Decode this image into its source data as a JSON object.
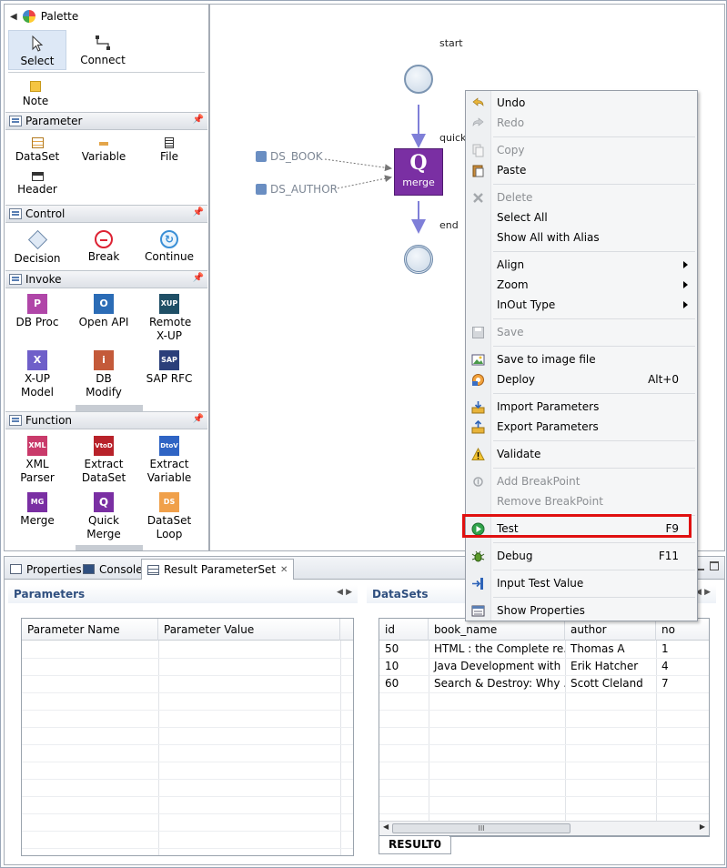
{
  "palette": {
    "title": "Palette",
    "tools": [
      {
        "label": "Select",
        "icon": "arrow-cursor-icon"
      },
      {
        "label": "Connect",
        "icon": "connect-icon"
      }
    ],
    "note_label": "Note",
    "sections": {
      "parameter": {
        "title": "Parameter",
        "items": [
          "DataSet",
          "Variable",
          "File",
          "Header"
        ]
      },
      "control": {
        "title": "Control",
        "items": [
          "Decision",
          "Break",
          "Continue"
        ]
      },
      "invoke": {
        "title": "Invoke",
        "items": [
          "DB Proc",
          "Open API",
          "Remote X-UP",
          "X-UP Model",
          "DB Modify",
          "SAP RFC"
        ]
      },
      "function": {
        "title": "Function",
        "items": [
          "XML Parser",
          "Extract DataSet",
          "Extract Variable",
          "Merge",
          "Quick Merge",
          "DataSet Loop"
        ]
      }
    },
    "icon_texts": {
      "dbproc": "P",
      "openapi": "O",
      "remotexup": "XUP",
      "xupmodel": "X",
      "dbmodify": "i",
      "saprfc": "SAP",
      "xmlparser": "XML",
      "extractds": "VtoD",
      "extractvar": "DtoV",
      "merge": "MG",
      "quickmerge": "Q",
      "dsloop": "DS"
    }
  },
  "canvas": {
    "start_label": "start",
    "end_label": "end",
    "quick_label": "quick",
    "ds_book": "DS_BOOK",
    "ds_author": "DS_AUTHOR",
    "node_letter": "Q",
    "node_sub": "merge"
  },
  "bottom": {
    "tabs": [
      "Properties",
      "Console",
      "Result ParameterSet"
    ],
    "parameters": {
      "title": "Parameters",
      "columns": [
        "Parameter Name",
        "Parameter Value"
      ]
    },
    "datasets": {
      "title": "DataSets",
      "columns": [
        "id",
        "book_name",
        "author",
        "no"
      ],
      "rows": [
        [
          "50",
          "HTML : the Complete re...",
          "Thomas A",
          "1"
        ],
        [
          "10",
          "Java Development with ...",
          "Erik Hatcher",
          "4"
        ],
        [
          "60",
          "Search & Destroy: Why ...",
          "Scott Cleland",
          "7"
        ]
      ],
      "sheet_tab": "RESULT0",
      "scroll_grip": "III"
    }
  },
  "context_menu": {
    "items": [
      {
        "label": "Undo",
        "icon": "undo-icon"
      },
      {
        "label": "Redo",
        "icon": "redo-icon",
        "disabled": true
      },
      {
        "label": "Copy",
        "icon": "copy-icon",
        "disabled": true
      },
      {
        "label": "Paste",
        "icon": "paste-icon"
      },
      {
        "label": "Delete",
        "icon": "delete-icon",
        "disabled": true
      },
      {
        "label": "Select All"
      },
      {
        "label": "Show All with Alias"
      },
      {
        "label": "Align",
        "submenu": true
      },
      {
        "label": "Zoom",
        "submenu": true
      },
      {
        "label": "InOut Type",
        "submenu": true
      },
      {
        "label": "Save",
        "icon": "save-icon",
        "disabled": true
      },
      {
        "label": "Save to image file",
        "icon": "image-icon"
      },
      {
        "label": "Deploy",
        "icon": "deploy-icon",
        "shortcut": "Alt+0"
      },
      {
        "label": "Import Parameters",
        "icon": "import-icon"
      },
      {
        "label": "Export Parameters",
        "icon": "export-icon"
      },
      {
        "label": "Validate",
        "icon": "warning-icon"
      },
      {
        "label": "Add BreakPoint",
        "icon": "breakpoint-icon",
        "disabled": true
      },
      {
        "label": "Remove BreakPoint",
        "disabled": true
      },
      {
        "label": "Test",
        "icon": "play-icon",
        "shortcut": "F9"
      },
      {
        "label": "Debug",
        "icon": "bug-icon",
        "shortcut": "F11"
      },
      {
        "label": "Input Test Value",
        "icon": "input-icon"
      },
      {
        "label": "Show Properties",
        "icon": "properties-icon"
      }
    ]
  },
  "colors": {
    "highlight": "#e01010",
    "node_purple": "#7a2fa3",
    "flow_arrow": "#7f7fd8",
    "panel_title": "#2f4f7f"
  }
}
